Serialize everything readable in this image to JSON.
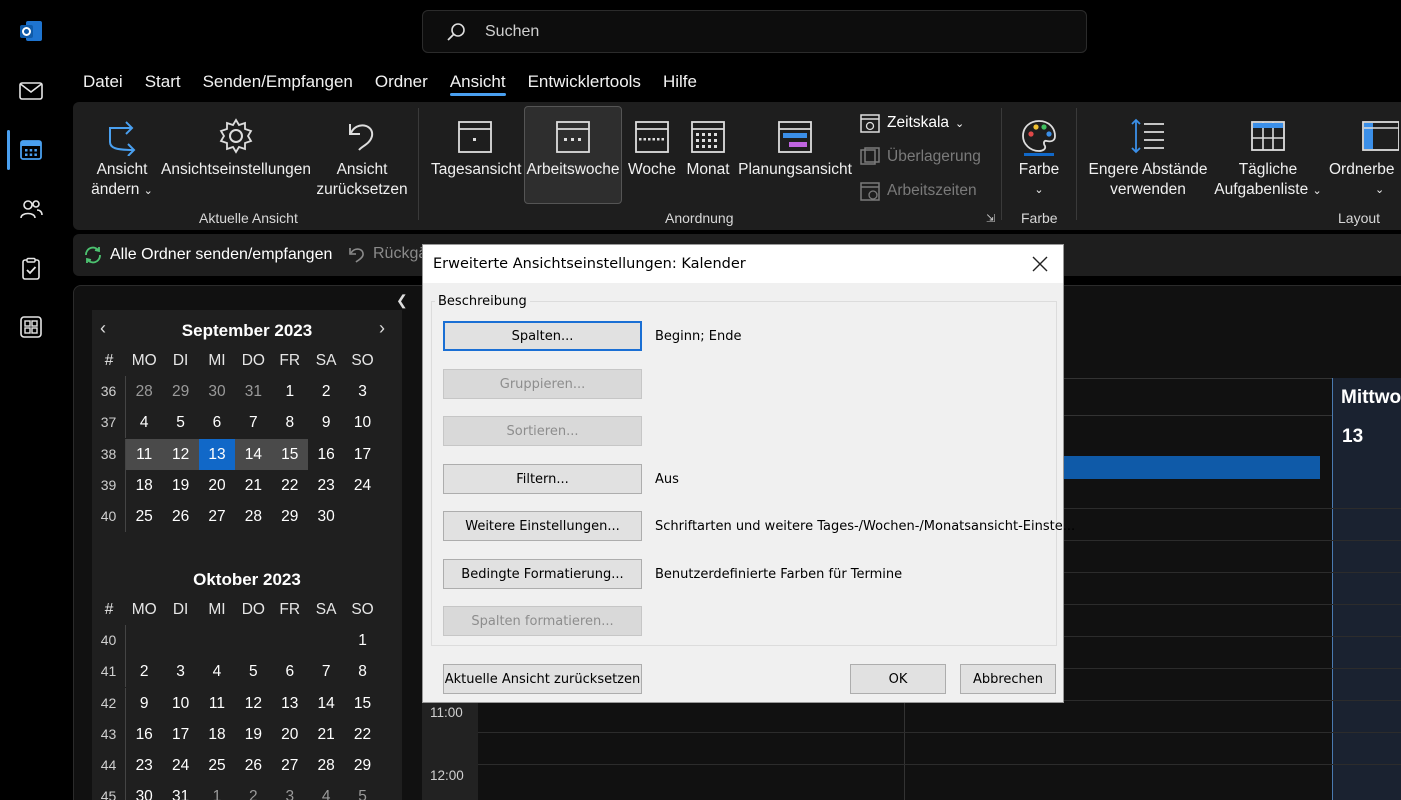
{
  "search": {
    "placeholder": "Suchen"
  },
  "menu": {
    "tabs": [
      "Datei",
      "Start",
      "Senden/Empfangen",
      "Ordner",
      "Ansicht",
      "Entwicklertools",
      "Hilfe"
    ],
    "active": "Ansicht"
  },
  "ribbon": {
    "current_view": {
      "change_view": {
        "line1": "Ansicht",
        "line2": "ändern"
      },
      "view_settings": "Ansichtseinstellungen",
      "reset_view": {
        "line1": "Ansicht",
        "line2": "zurücksetzen"
      },
      "group_label": "Aktuelle Ansicht"
    },
    "arrangement": {
      "day": "Tagesansicht",
      "work_week": "Arbeitswoche",
      "week": "Woche",
      "month": "Monat",
      "schedule": "Planungsansicht",
      "time_scale": "Zeitskala",
      "overlay": "Überlagerung",
      "work_hours": "Arbeitszeiten",
      "group_label": "Anordnung"
    },
    "color": {
      "label": "Farbe",
      "group_label": "Farbe"
    },
    "layout": {
      "compact": {
        "line1": "Engere Abstände",
        "line2": "verwenden"
      },
      "daily_tasks": {
        "line1": "Tägliche",
        "line2": "Aufgabenliste"
      },
      "folder_pane": "Ordnerbe",
      "group_label": "Layout"
    }
  },
  "quick_access": {
    "sync_label": "Alle Ordner senden/empfangen",
    "undo_label": "Rückgä"
  },
  "calendar_september": {
    "title": "September 2023",
    "headers": [
      "#",
      "MO",
      "DI",
      "MI",
      "DO",
      "FR",
      "SA",
      "SO"
    ],
    "rows": [
      [
        "36",
        "28",
        "29",
        "30",
        "31",
        "1",
        "2",
        "3"
      ],
      [
        "37",
        "4",
        "5",
        "6",
        "7",
        "8",
        "9",
        "10"
      ],
      [
        "38",
        "11",
        "12",
        "13",
        "14",
        "15",
        "16",
        "17"
      ],
      [
        "39",
        "18",
        "19",
        "20",
        "21",
        "22",
        "23",
        "24"
      ],
      [
        "40",
        "25",
        "26",
        "27",
        "28",
        "29",
        "30",
        ""
      ]
    ]
  },
  "calendar_october": {
    "title": "Oktober 2023",
    "headers": [
      "#",
      "MO",
      "DI",
      "MI",
      "DO",
      "FR",
      "SA",
      "SO"
    ],
    "rows": [
      [
        "40",
        "",
        "",
        "",
        "",
        "",
        "",
        "1"
      ],
      [
        "41",
        "2",
        "3",
        "4",
        "5",
        "6",
        "7",
        "8"
      ],
      [
        "42",
        "9",
        "10",
        "11",
        "12",
        "13",
        "14",
        "15"
      ],
      [
        "43",
        "16",
        "17",
        "18",
        "19",
        "20",
        "21",
        "22"
      ],
      [
        "44",
        "23",
        "24",
        "25",
        "26",
        "27",
        "28",
        "29"
      ],
      [
        "45",
        "30",
        "31",
        "1",
        "2",
        "3",
        "4",
        "5"
      ]
    ]
  },
  "day_view": {
    "wednesday_name": "Mittwo",
    "wednesday_num": "13",
    "times": [
      "11:00",
      "12:00"
    ]
  },
  "dialog": {
    "title": "Erweiterte Ansichtseinstellungen: Kalender",
    "group_label": "Beschreibung",
    "buttons": {
      "columns": "Spalten...",
      "group": "Gruppieren...",
      "sort": "Sortieren...",
      "filter": "Filtern...",
      "more_settings": "Weitere Einstellungen...",
      "cond_format": "Bedingte Formatierung...",
      "format_columns": "Spalten formatieren...",
      "reset": "Aktuelle Ansicht zurücksetzen",
      "ok": "OK",
      "cancel": "Abbrechen"
    },
    "descriptions": {
      "columns": "Beginn; Ende",
      "filter": "Aus",
      "more_settings": "Schriftarten und weitere Tages-/Wochen-/Monatsansicht-Einste...",
      "cond_format": "Benutzerdefinierte Farben für Termine"
    }
  },
  "colors": {
    "accent": "#4aa0f0",
    "today": "#1168c8",
    "event": "#0f5aa8"
  }
}
